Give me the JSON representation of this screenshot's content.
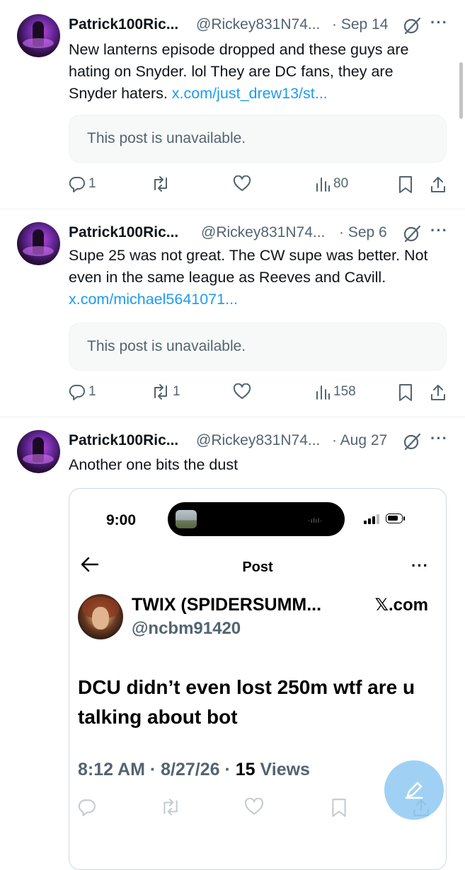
{
  "posts": [
    {
      "name": "Patrick100Ric...",
      "handle": "@Rickey831N74...",
      "date": "· Sep 14",
      "more": "···",
      "text_main": "New lanterns episode dropped and these guys are hating on Snyder. lol They are DC fans, they are Snyder haters. ",
      "text_link": "x.com/just_drew13/st...",
      "quote": "This post is unavailable.",
      "replies": "1",
      "reposts": "",
      "views": "80"
    },
    {
      "name": "Patrick100Ric...",
      "handle": "@Rickey831N74...",
      "date": "· Sep 6",
      "more": "···",
      "text_main": "Supe 25 was not great. The CW supe was better. Not even in the same league as Reeves and Cavill. ",
      "text_link": "x.com/michael5641071...",
      "quote": "This post is unavailable.",
      "replies": "1",
      "reposts": "1",
      "views": "158"
    },
    {
      "name": "Patrick100Ric...",
      "handle": "@Rickey831N74...",
      "date": "· Aug 27",
      "more": "···",
      "text_main": "Another one bits the dust"
    }
  ],
  "embed": {
    "status_time": "9:00",
    "island_dots": "·ılıl·",
    "title": "Post",
    "more": "···",
    "name": "TWIX (SPIDERSUMM...",
    "source": "𝕏.com",
    "handle": "@ncbm91420",
    "body": "DCU didn’t even lost 250m wtf are u talking about bot",
    "meta_time": "8:12 AM · 8/27/26 · ",
    "meta_views_count": "15",
    "meta_views_label": " Views"
  },
  "colors": {
    "link": "#1d9bf0",
    "muted": "#536471",
    "divider": "#eff3f4",
    "fab": "#78bef0"
  },
  "icons": [
    "grok-icon",
    "reply-icon",
    "repost-icon",
    "like-icon",
    "views-icon",
    "bookmark-icon",
    "share-icon",
    "back-arrow-icon",
    "compose-icon"
  ]
}
